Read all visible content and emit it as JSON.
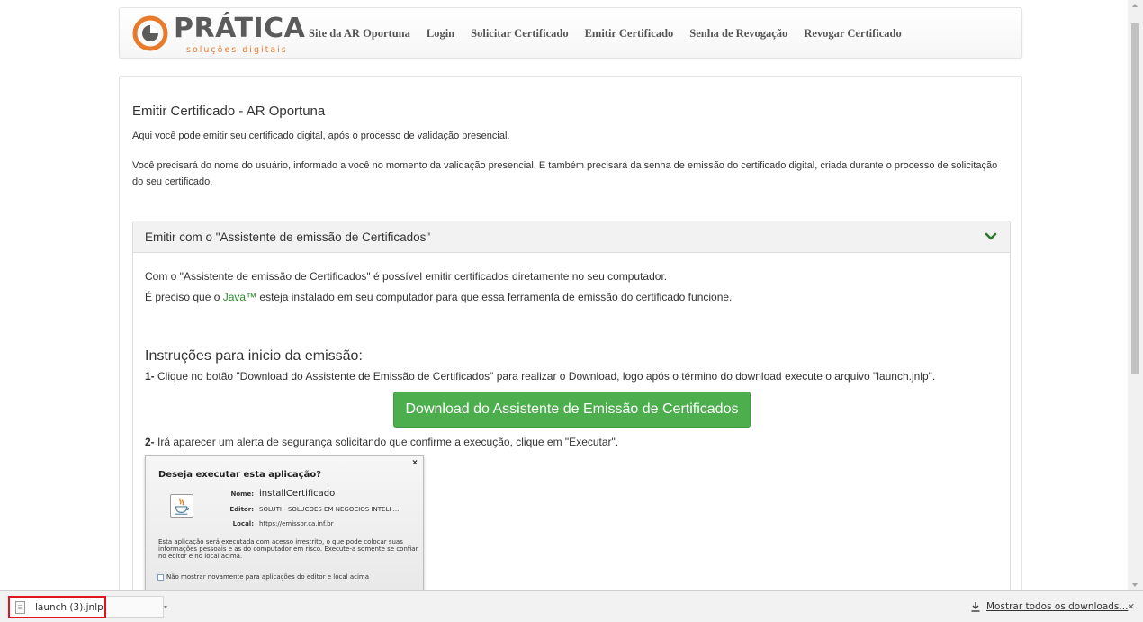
{
  "brand": {
    "name": "PRÁTICA",
    "tagline": "soluções digitais",
    "accent_color": "#e87a2c"
  },
  "nav": {
    "links": [
      "Site da AR Oportuna",
      "Login",
      "Solicitar Certificado",
      "Emitir Certificado",
      "Senha de Revogação",
      "Revogar Certificado"
    ]
  },
  "main": {
    "title": "Emitir Certificado - AR Oportuna",
    "intro": "Aqui você pode emitir seu certificado digital, após o processo de validação presencial.",
    "intro2": "Você precisará do nome do usuário, informado a você no momento da validação presencial. E também precisará da senha de emissão do certificado digital, criada durante o processo de solicitação do seu certificado."
  },
  "panel": {
    "title": "Emitir com o \"Assistente de emissão de Certificados\"",
    "chevron_icon": "chevron-down-icon",
    "line1": "Com o \"Assistente de emissão de Certificados\" é possível emitir certificados diretamente no seu computador.",
    "line2_before": "É preciso que o ",
    "line2_link": "Java™",
    "line2_after": " esteja instalado em seu computador para que essa ferramenta de emissão do certificado funcione.",
    "instructions_title": "Instruções para inicio da emissão:",
    "step1_num": "1-",
    "step1_text": " Clique no botão \"Download do Assistente de Emissão de Certificados\" para realizar o Download, logo após o término do download execute o arquivo \"launch.jnlp\".",
    "download_button": "Download do Assistente de Emissão de Certificados",
    "step2_num": "2-",
    "step2_text": " Irá aparecer um alerta de segurança solicitando que confirme a execução, clique em \"Executar\"."
  },
  "java_dialog": {
    "title": "Deseja executar esta aplicação?",
    "name_label": "Nome:",
    "name_value": "installCertificado",
    "editor_label": "Editor:",
    "editor_value": "SOLUTI - SOLUCOES EM NEGOCIOS INTELI ...",
    "local_label": "Local:",
    "local_value": "https://emissor.ca.inf.br",
    "warning": "Esta aplicação será executada com acesso irrestrito, o que pode colocar suas informações pessoais e as do computador em risco. Execute-a somente se confiar no editor e no local acima.",
    "checkbox_label": "Não mostrar novamente para aplicações do editor e local acima",
    "close": "×"
  },
  "downloads": {
    "file_name": "launch (3).jnlp",
    "show_all": "Mostrar todos os downloads...",
    "close": "×"
  }
}
